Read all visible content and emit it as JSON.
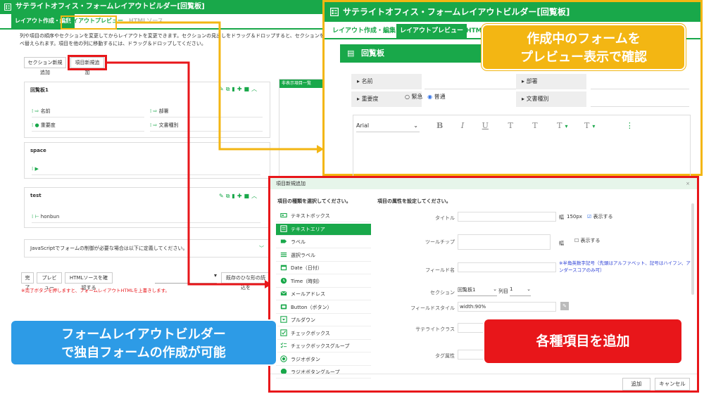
{
  "base": {
    "title": "サテライトオフィス・フォームレイアウトビルダー[回覧板]",
    "tabs": [
      "レイアウト作成・編集",
      "レイアウトプレビュー",
      "HTMLソース"
    ],
    "description": "列や項目の順序やセクションを変更してからレイアウトを変更できます。セクションの見出しをドラッグ＆ドロップすると、セクションを並べ替えられます。項目を他の列に移動するには、ドラッグ＆ドロップしてください。",
    "section_add_label": "セクション新規追加",
    "item_add_label": "項目新規追加",
    "unused_panel_title": "非表示項目一覧",
    "sections": [
      {
        "title": "回覧板1",
        "fields_left": [
          "名前",
          "重要度"
        ],
        "fields_right": [
          "部署",
          "文書種別"
        ]
      },
      {
        "title": "space",
        "fields_left": [],
        "fields_right": []
      },
      {
        "title": "test",
        "fields_left": [
          "honbun"
        ],
        "fields_right": []
      }
    ],
    "js_section": "JavaScriptでフォームの制御が必要な場合は以下に定義してください。",
    "buttons": [
      "完了",
      "プレビュー",
      "HTMLソースを確認する"
    ],
    "load_button": "既存のひな形の読込を",
    "warning": "※完了ボタンを押しますと、フォームレイアウトHTMLを上書きします。"
  },
  "preview": {
    "title": "サテライトオフィス・フォームレイアウトビルダー[回覧板]",
    "tabs": [
      "レイアウト作成・編集",
      "レイアウトプレビュー",
      "HTML"
    ],
    "form_title": "回覧板",
    "fields": {
      "name": "名前",
      "dept": "部署",
      "priority": "重要度",
      "doc_type": "文書種別"
    },
    "priority_options": [
      "緊急",
      "普通"
    ],
    "priority_selected": "普通",
    "font_select": "Arial",
    "toolbar_glyphs": [
      "B",
      "I",
      "U",
      "T",
      "T",
      "T",
      "T",
      "⋮"
    ]
  },
  "dialog": {
    "title": "項目新規追加",
    "close": "×",
    "left_heading": "項目の種類を選択してください。",
    "right_heading": "項目の属性を設定してください。",
    "types": [
      {
        "label": "テキストボックス",
        "icon": "textbox-icon"
      },
      {
        "label": "テキストエリア",
        "icon": "textarea-icon"
      },
      {
        "label": "ラベル",
        "icon": "tag-icon"
      },
      {
        "label": "選択ラベル",
        "icon": "list-icon"
      },
      {
        "label": "Date（日付）",
        "icon": "calendar-icon"
      },
      {
        "label": "Time（時刻）",
        "icon": "clock-icon"
      },
      {
        "label": "メールアドレス",
        "icon": "mail-icon"
      },
      {
        "label": "Button（ボタン）",
        "icon": "button-icon"
      },
      {
        "label": "プルダウン",
        "icon": "pulldown-icon"
      },
      {
        "label": "チェックボックス",
        "icon": "checkbox-icon"
      },
      {
        "label": "チェックボックスグループ",
        "icon": "checkbox-group-icon"
      },
      {
        "label": "ラジオボタン",
        "icon": "radio-icon"
      },
      {
        "label": "ラジオボタングループ",
        "icon": "radio-group-icon"
      }
    ],
    "selected_type": "テキストエリア",
    "props": {
      "title_label": "タイトル",
      "width_label": "幅",
      "width_value": "150px",
      "show_label": "表示する",
      "tooltip_label": "ツールチップ",
      "field_name_label": "フィールド名",
      "field_name_note": "※半角英数字記号（先頭はアルファベット、記号はハイフン、アンダースコアのみ可）",
      "section_label": "セクション",
      "section_value": "回覧板1",
      "column_label": "列目",
      "column_value": "1",
      "style_label": "フィールドスタイル",
      "style_value": "width:90%",
      "class_label": "サテライトクラス",
      "tag_label": "タグ属性"
    },
    "add_button": "追加",
    "cancel_button": "キャンセル"
  },
  "callouts": {
    "preview": [
      "作成中のフォームを",
      "プレビュー表示で確認"
    ],
    "builder": [
      "フォームレイアウトビルダー",
      "で独自フォームの作成が可能"
    ],
    "add": "各種項目を追加"
  },
  "colors": {
    "green": "#19a84a",
    "yellow": "#f3b613",
    "red": "#e8161a",
    "blue": "#2d9be6"
  }
}
